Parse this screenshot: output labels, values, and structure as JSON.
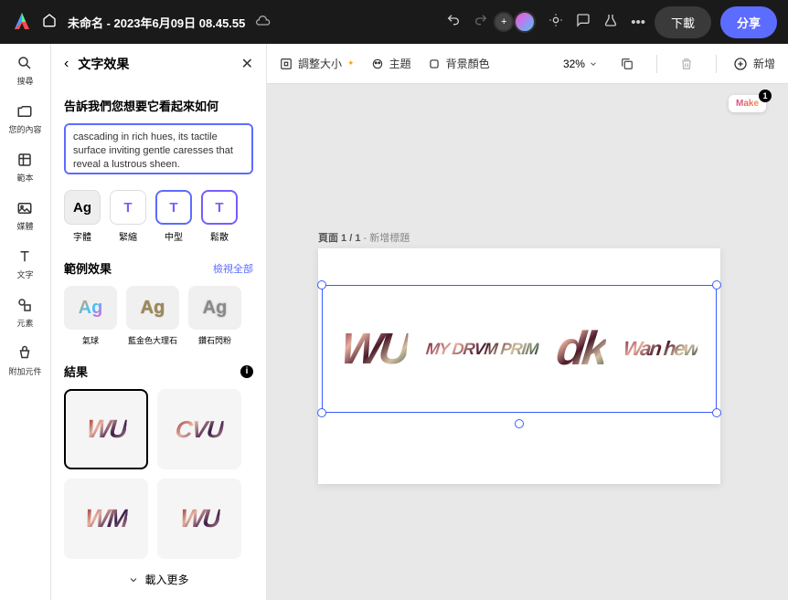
{
  "topbar": {
    "title": "未命名 - 2023年6月09日 08.45.55",
    "download": "下載",
    "share": "分享"
  },
  "sidebar": {
    "items": [
      {
        "label": "搜尋"
      },
      {
        "label": "您的內容"
      },
      {
        "label": "範本"
      },
      {
        "label": "媒體"
      },
      {
        "label": "文字"
      },
      {
        "label": "元素"
      },
      {
        "label": "附加元件"
      }
    ]
  },
  "panel": {
    "title": "文字效果",
    "prompt_label": "告訴我們您想要它看起來如何",
    "prompt_value": "cascading in rich hues, its tactile surface inviting gentle caresses that reveal a lustrous sheen.",
    "styles": [
      {
        "label": "字體",
        "glyph": "Ag"
      },
      {
        "label": "緊縮",
        "glyph": "T"
      },
      {
        "label": "中型",
        "glyph": "T"
      },
      {
        "label": "鬆散",
        "glyph": "T"
      }
    ],
    "examples": {
      "title": "範例效果",
      "view_all": "檢視全部",
      "items": [
        {
          "label": "氣球",
          "glyph": "Ag"
        },
        {
          "label": "藍金色大理石",
          "glyph": "Ag"
        },
        {
          "label": "鑽石閃粉",
          "glyph": "Ag"
        }
      ]
    },
    "results": {
      "title": "結果",
      "items": [
        "WU",
        "CVU",
        "WM",
        "WU"
      ]
    },
    "load_more": "載入更多"
  },
  "canvas_toolbar": {
    "resize": "調整大小",
    "theme": "主題",
    "bg": "背景顏色",
    "zoom": "32%",
    "add": "新增"
  },
  "canvas": {
    "page_label": "頁面 1 / 1",
    "page_sub": " - 新增標題",
    "badge": "Make",
    "glyphs": [
      "WU",
      "MY\nDRVM\nPRIM",
      "dk",
      "Wan\nhew"
    ]
  }
}
